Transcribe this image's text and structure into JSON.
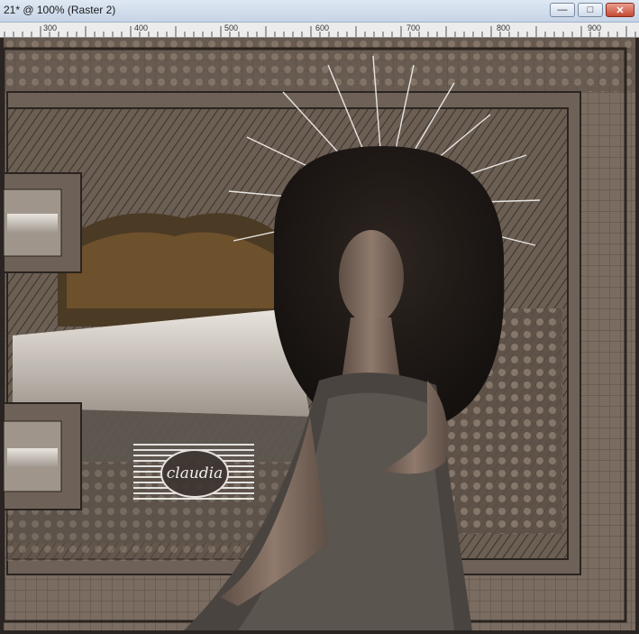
{
  "window": {
    "title": "21* @ 100% (Raster 2)",
    "minimize_icon": "minimize-icon",
    "maximize_icon": "maximize-icon",
    "close_icon": "close-icon"
  },
  "ruler": {
    "labels": [
      "300",
      "400",
      "500",
      "600",
      "700",
      "800",
      "900"
    ]
  },
  "canvas": {
    "watermark_text": "claudia",
    "colors": {
      "frame": "#6e6157",
      "background": "#4a4038",
      "accent": "#8a7b6e"
    }
  }
}
